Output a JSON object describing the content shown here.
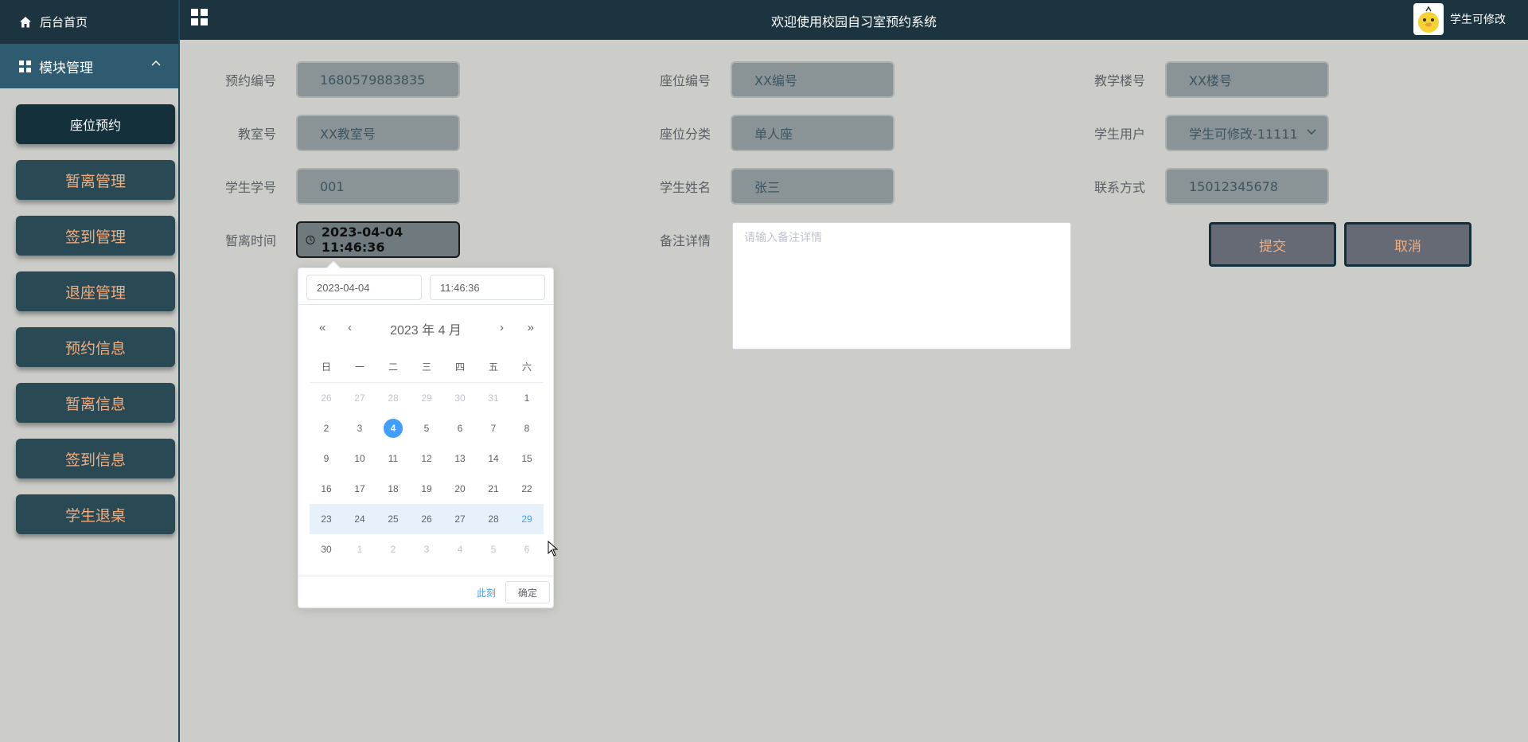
{
  "sidebar": {
    "home_label": "后台首页",
    "module_label": "模块管理",
    "items": [
      {
        "label": "座位预约"
      },
      {
        "label": "暂离管理"
      },
      {
        "label": "签到管理"
      },
      {
        "label": "退座管理"
      },
      {
        "label": "预约信息"
      },
      {
        "label": "暂离信息"
      },
      {
        "label": "签到信息"
      },
      {
        "label": "学生退桌"
      }
    ]
  },
  "header": {
    "title": "欢迎使用校园自习室预约系统",
    "user_name": "学生可修改"
  },
  "form": {
    "reservation_no": {
      "label": "预约编号",
      "value": "1680579883835"
    },
    "seat_no": {
      "label": "座位编号",
      "value": "XX编号"
    },
    "building_no": {
      "label": "教学楼号",
      "value": "XX楼号"
    },
    "classroom_no": {
      "label": "教室号",
      "value": "XX教室号"
    },
    "seat_category": {
      "label": "座位分类",
      "value": "单人座"
    },
    "student_user": {
      "label": "学生用户",
      "value": "学生可修改-11111"
    },
    "student_id": {
      "label": "学生学号",
      "value": "001"
    },
    "student_name": {
      "label": "学生姓名",
      "value": "张三"
    },
    "contact": {
      "label": "联系方式",
      "value": "15012345678"
    },
    "leave_time": {
      "label": "暂离时间",
      "value": "2023-04-04 11:46:36"
    },
    "remarks": {
      "label": "备注详情",
      "placeholder": "请输入备注详情"
    },
    "submit_label": "提交",
    "cancel_label": "取消"
  },
  "datepicker": {
    "date_input": "2023-04-04",
    "time_input": "11:46:36",
    "header": "2023 年  4 月",
    "weekdays": [
      "日",
      "一",
      "二",
      "三",
      "四",
      "五",
      "六"
    ],
    "weeks": [
      [
        "26",
        "27",
        "28",
        "29",
        "30",
        "31",
        "1"
      ],
      [
        "2",
        "3",
        "4",
        "5",
        "6",
        "7",
        "8"
      ],
      [
        "9",
        "10",
        "11",
        "12",
        "13",
        "14",
        "15"
      ],
      [
        "16",
        "17",
        "18",
        "19",
        "20",
        "21",
        "22"
      ],
      [
        "23",
        "24",
        "25",
        "26",
        "27",
        "28",
        "29"
      ],
      [
        "30",
        "1",
        "2",
        "3",
        "4",
        "5",
        "6"
      ]
    ],
    "selected_day": "4",
    "now_label": "此刻",
    "confirm_label": "确定"
  }
}
